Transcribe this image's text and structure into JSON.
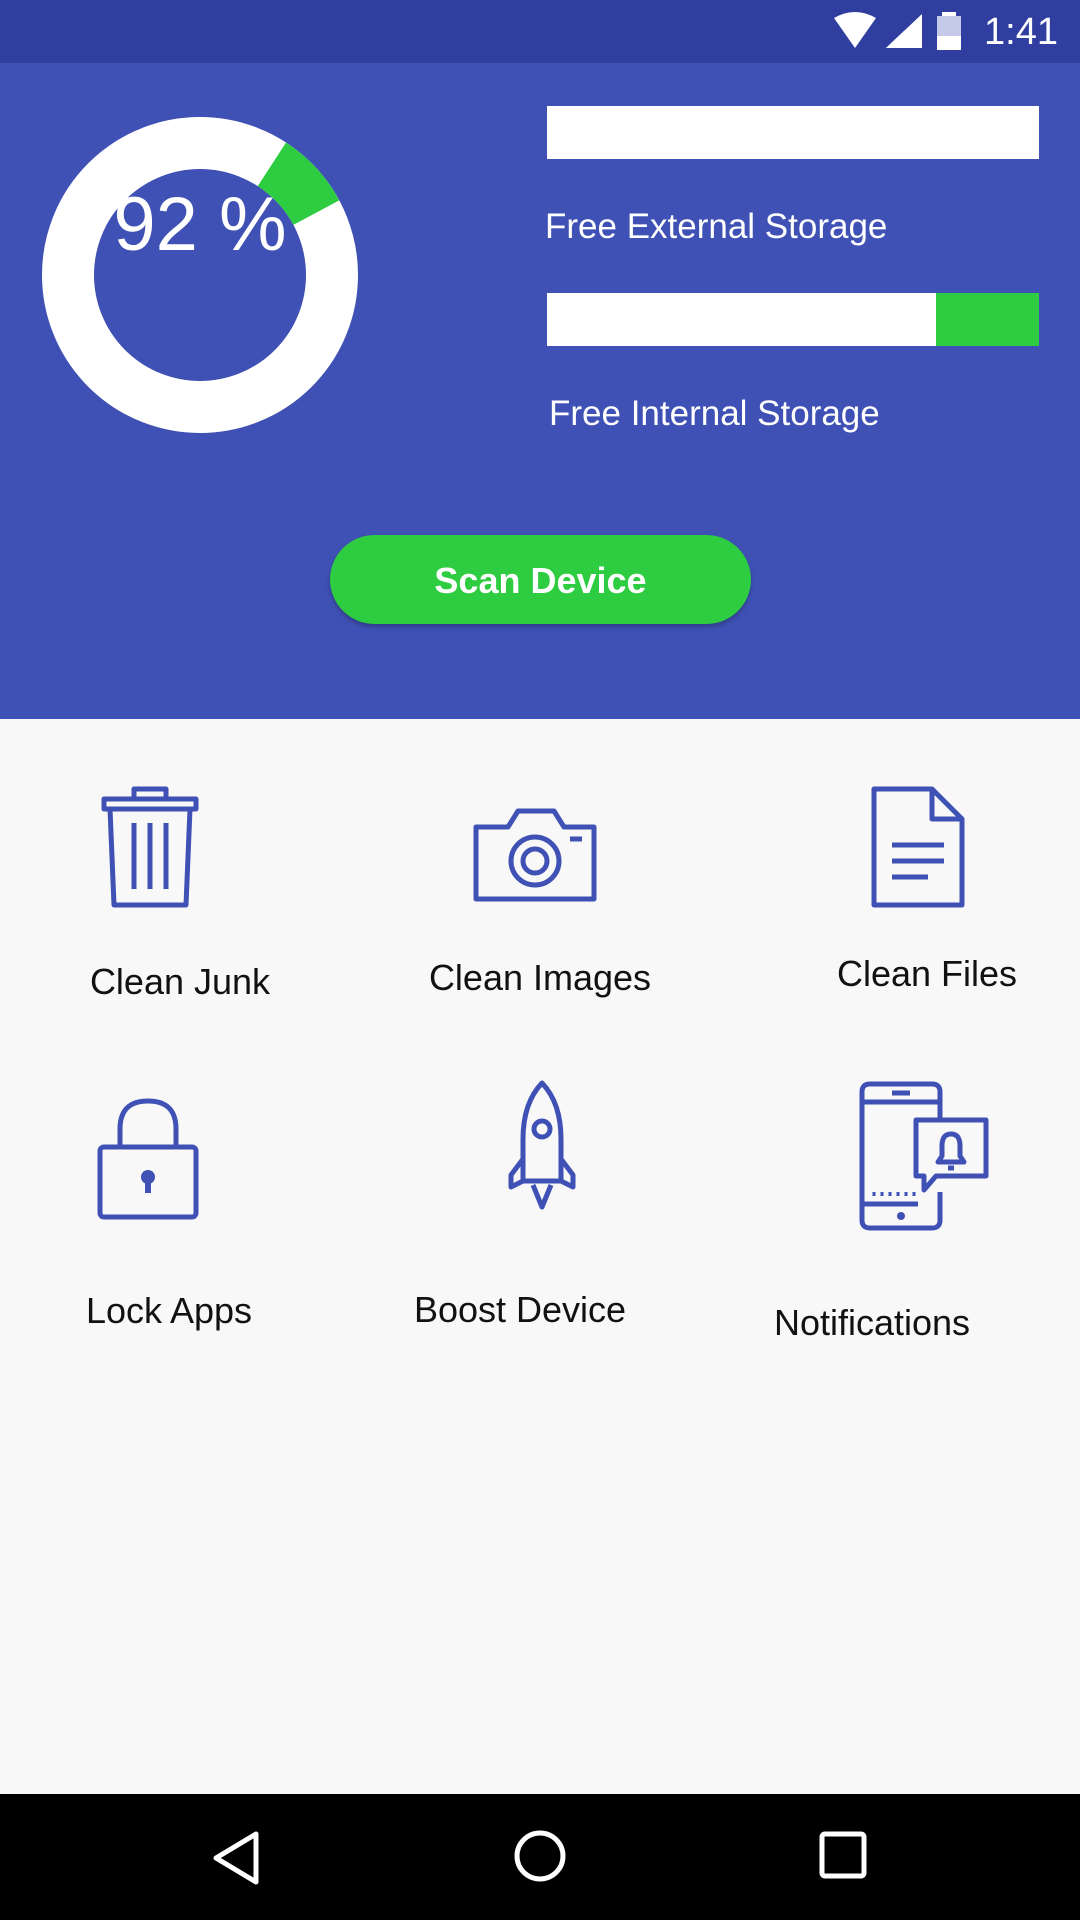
{
  "status_bar": {
    "time": "1:41",
    "icons": [
      "wifi-icon",
      "signal-icon",
      "battery-icon"
    ]
  },
  "storage": {
    "overall_percent_label": "92 %",
    "overall_used_fraction": 0.08,
    "external": {
      "label": "Free External Storage",
      "used_fraction": 0.0
    },
    "internal": {
      "label": "Free Internal Storage",
      "used_fraction": 0.21
    }
  },
  "scan_button": {
    "label": "Scan Device"
  },
  "tools": [
    {
      "label": "Clean Junk",
      "icon": "trash-icon"
    },
    {
      "label": "Clean Images",
      "icon": "camera-icon"
    },
    {
      "label": "Clean Files",
      "icon": "file-icon"
    },
    {
      "label": "Lock Apps",
      "icon": "lock-icon"
    },
    {
      "label": "Boost Device",
      "icon": "rocket-icon"
    },
    {
      "label": "Notifications",
      "icon": "phone-bell-icon"
    }
  ],
  "nav_bar": {
    "icons": [
      "back-icon",
      "home-icon",
      "recents-icon"
    ]
  },
  "colors": {
    "primary": "#3f51b5",
    "primary_dark": "#303f9f",
    "accent": "#2ecc40",
    "icon": "#3f51b5"
  }
}
